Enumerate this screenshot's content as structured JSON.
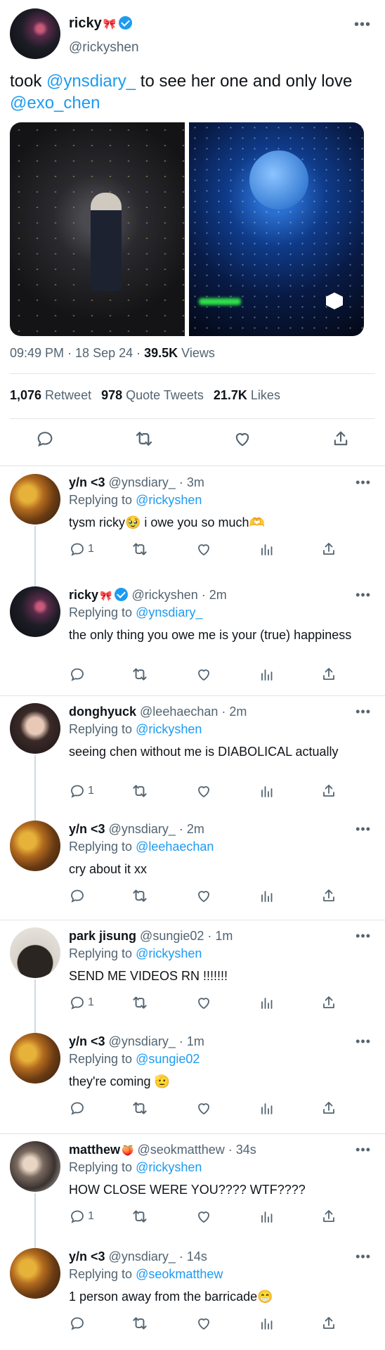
{
  "main_tweet": {
    "name": "ricky",
    "name_emoji": "🎀",
    "handle": "@rickyshen",
    "more": "•••",
    "text_parts": {
      "t1": "took ",
      "m1": "@ynsdiary_",
      "t2": " to see her one and only love ",
      "m2": "@exo_chen"
    },
    "time": "09:49 PM · 18 Sep 24 · ",
    "views_count": "39.5K",
    "views_label": " Views",
    "retweets_count": "1,076",
    "retweets_label": "Retweet",
    "quotes_count": "978",
    "quotes_label": "Quote Tweets",
    "likes_count": "21.7K",
    "likes_label": "Likes"
  },
  "replies": [
    {
      "name": "y/n <3",
      "handle": "@ynsdiary_ · 3m",
      "reply_prefix": "Replying to ",
      "reply_to": "@rickyshen",
      "text": "tysm ricky🥹  i owe you so much🫶",
      "reply_count": "1",
      "more": "•••"
    },
    {
      "name": "ricky",
      "name_emoji": "🎀",
      "handle": "@rickyshen · 2m",
      "reply_prefix": "Replying to ",
      "reply_to": "@ynsdiary_",
      "text": "the only thing you owe me is your (true) happiness",
      "reply_count": "",
      "more": "•••"
    },
    {
      "name": "donghyuck",
      "handle": "@leehaechan · 2m",
      "reply_prefix": "Replying to ",
      "reply_to": "@rickyshen",
      "text": "seeing chen without me is DIABOLICAL actually",
      "reply_count": "1",
      "more": "•••"
    },
    {
      "name": "y/n <3",
      "handle": "@ynsdiary_ · 2m",
      "reply_prefix": "Replying to ",
      "reply_to": "@leehaechan",
      "text": "cry about it xx",
      "reply_count": "",
      "more": "•••"
    },
    {
      "name": "park jisung",
      "handle": "@sungie02 · 1m",
      "reply_prefix": "Replying to ",
      "reply_to": "@rickyshen",
      "text": "SEND ME VIDEOS RN !!!!!!!",
      "reply_count": "1",
      "more": "•••"
    },
    {
      "name": "y/n <3",
      "handle": "@ynsdiary_ · 1m",
      "reply_prefix": "Replying to ",
      "reply_to": "@sungie02",
      "text": "they're coming 🫡",
      "reply_count": "",
      "more": "•••"
    },
    {
      "name": "matthew",
      "name_emoji": "🍑",
      "handle": "@seokmatthew · 34s",
      "reply_prefix": "Replying to ",
      "reply_to": "@rickyshen",
      "text": "HOW CLOSE WERE YOU???? WTF????",
      "reply_count": "1",
      "more": "•••"
    },
    {
      "name": "y/n <3",
      "handle": "@ynsdiary_ · 14s",
      "reply_prefix": "Replying to ",
      "reply_to": "@seokmatthew",
      "text": "1 person away from the barricade😁",
      "reply_count": "",
      "more": "•••"
    }
  ]
}
